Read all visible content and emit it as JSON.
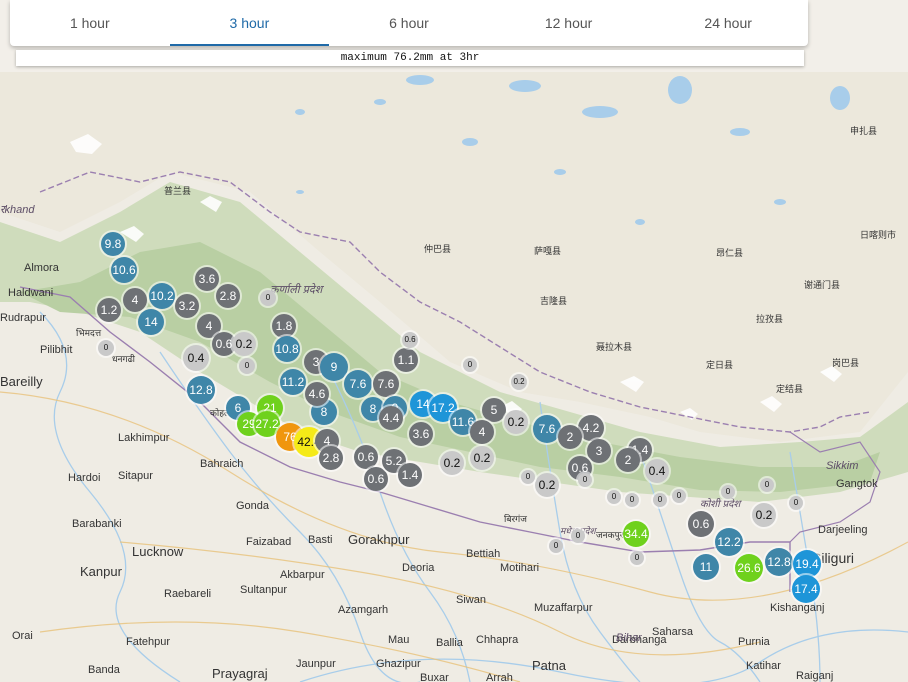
{
  "tabs": [
    {
      "label": "1 hour",
      "active": false
    },
    {
      "label": "3 hour",
      "active": true
    },
    {
      "label": "6 hour",
      "active": false
    },
    {
      "label": "12 hour",
      "active": false
    },
    {
      "label": "24 hour",
      "active": false
    }
  ],
  "summary": "maximum 76.2mm at 3hr",
  "colors": {
    "gray": "#6e7175",
    "light_gray": "#c9c9c9",
    "steel_blue": "#3f86a8",
    "blue": "#1e95d8",
    "green": "#6fd11d",
    "orange": "#f0960e",
    "yellow": "#f5ea18",
    "active_tab": "#1f6aa8"
  },
  "places": [
    "रkhand",
    "Almora",
    "Haldwani",
    "Rudrapur",
    "Pilibhit",
    "Bareilly",
    "Lakhimpur",
    "Bahraich",
    "Hardoi",
    "Sitapur",
    "Gonda",
    "Barabanki",
    "Lucknow",
    "Faizabad",
    "Basti",
    "Gorakhpur",
    "Kanpur",
    "Akbarpur",
    "Raebareli",
    "Sultanpur",
    "Azamgarh",
    "Orai",
    "Fatehpur",
    "Mau",
    "Ballia",
    "Banda",
    "Prayagraj",
    "Jaunpur",
    "Ghazipur",
    "Buxar",
    "Arrah",
    "Patna",
    "Deoria",
    "Bettiah",
    "Motihari",
    "Siwan",
    "Chhapra",
    "Muzaffarpur",
    "Darbhanga",
    "Saharsa",
    "Purnia",
    "Katihar",
    "Kishanganj",
    "Siliguri",
    "Gangtok",
    "Sikkim",
    "Bihar",
    "Raiganj",
    "कर्णाली प्रदेश",
    "कोशी प्रदेश",
    "मधेश प्रदेश",
    "जनकपुर",
    "बिरगंज",
    "भिमदत्त",
    "धनगढी",
    "कोहलपुर",
    "Darjeeling",
    "普兰县",
    "仲巴县",
    "萨嘎县",
    "吉隆县",
    "昂仁县",
    "聂拉木县",
    "定日县",
    "拉孜县",
    "定结县",
    "岗巴县",
    "谢通门县",
    "日喀则市",
    "申扎县"
  ],
  "rainfall_mm": [
    "9.8",
    "10.6",
    "3.6",
    "2.8",
    "4",
    "10.2",
    "3.2",
    "1.2",
    "14",
    "4",
    "0.6",
    "0.2",
    "1.8",
    "10.8",
    "0.4",
    "3",
    "9",
    "1.1",
    "11.2",
    "8",
    "7.6",
    "7.6",
    "4.6",
    "12.8",
    "6",
    "21",
    "29",
    "27.2",
    "76",
    "42.4",
    "4",
    "8",
    "9",
    "4.4",
    "3.6",
    "14",
    "17.2",
    "11.6",
    "5",
    "0.2",
    "4",
    "7.6",
    "4.2",
    "2",
    "3",
    "1.4",
    "0.6",
    "2",
    "0.4",
    "0.6",
    "0.2",
    "0.6",
    "5.2",
    "1.4",
    "2.8",
    "0.2",
    "0.2",
    "0.6",
    "12.2",
    "11",
    "26.6",
    "12.8",
    "19.4",
    "17.4",
    "34.4",
    "0.2",
    "0.2",
    "0.6",
    "0",
    "0",
    "0",
    "0",
    "0",
    "0",
    "0",
    "0",
    "0",
    "0",
    "0",
    "0",
    "0",
    "0",
    "0",
    "0"
  ]
}
